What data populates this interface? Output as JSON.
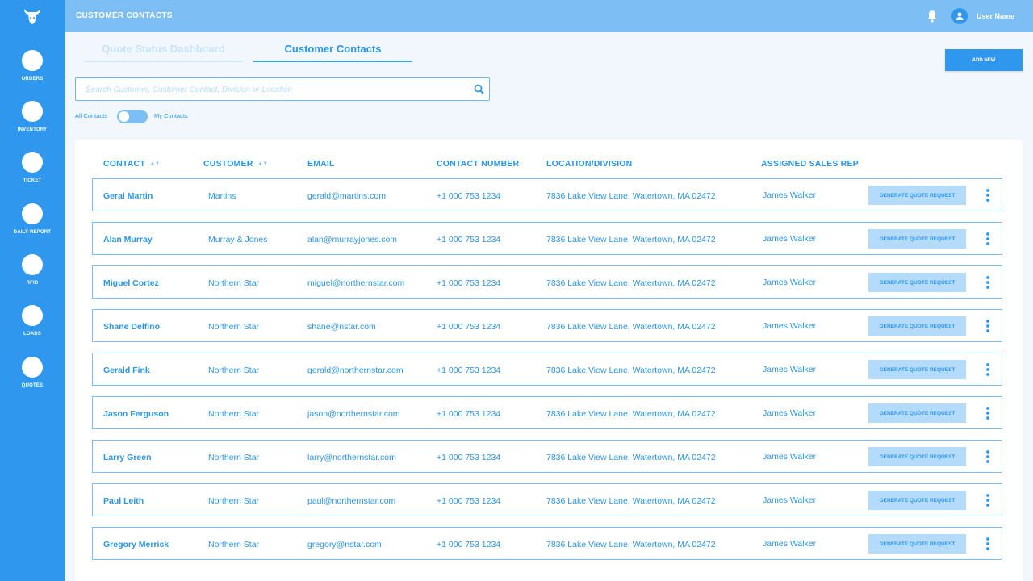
{
  "app": {
    "title": "CUSTOMER CONTACTS",
    "user_name": "User Name"
  },
  "sidebar": {
    "items": [
      {
        "label": "ORDERS",
        "icon": "orders-icon"
      },
      {
        "label": "INVENTORY",
        "icon": "inventory-icon"
      },
      {
        "label": "TICKET",
        "icon": "ticket-icon"
      },
      {
        "label": "DAILY REPORT",
        "icon": "daily-report-icon"
      },
      {
        "label": "RFID",
        "icon": "rfid-icon"
      },
      {
        "label": "LOADS",
        "icon": "loads-icon"
      },
      {
        "label": "QUOTES",
        "icon": "quotes-icon"
      }
    ]
  },
  "tabs": [
    {
      "label": "Quote Status Dashboard",
      "active": false
    },
    {
      "label": "Customer Contacts",
      "active": true
    }
  ],
  "toolbar": {
    "add_label": "ADD NEW"
  },
  "search": {
    "placeholder": "Search Customer, Customer Contact, Division or Location",
    "value": ""
  },
  "toggle": {
    "left_label": "All Contacts",
    "right_label": "My Contacts"
  },
  "table": {
    "headers": {
      "contact": "CONTACT",
      "customer": "CUSTOMER",
      "email": "EMAIL",
      "phone": "CONTACT NUMBER",
      "location": "LOCATION/DIVISION",
      "rep": "ASSIGNED SALES REP"
    },
    "action_label": "GENERATE QUOTE REQUEST",
    "rows": [
      {
        "contact": "Geral Martin",
        "customer": "Martins",
        "email": "gerald@martins.com",
        "phone": "+1 000 753 1234",
        "location": "7836 Lake View Lane, Watertown, MA 02472",
        "rep": "James Walker"
      },
      {
        "contact": "Alan Murray",
        "customer": "Murray & Jones",
        "email": "alan@murrayjones.com",
        "phone": "+1 000 753 1234",
        "location": "7836 Lake View Lane, Watertown, MA 02472",
        "rep": "James Walker"
      },
      {
        "contact": "Miguel Cortez",
        "customer": "Northern Star",
        "email": "miguel@northernstar.com",
        "phone": "+1 000 753 1234",
        "location": "7836 Lake View Lane, Watertown, MA 02472",
        "rep": "James Walker"
      },
      {
        "contact": "Shane Delfino",
        "customer": "Northern Star",
        "email": "shane@nstar.com",
        "phone": "+1 000 753 1234",
        "location": "7836 Lake View Lane, Watertown, MA 02472",
        "rep": "James Walker"
      },
      {
        "contact": "Gerald Fink",
        "customer": "Northern Star",
        "email": "gerald@northernstar.com",
        "phone": "+1 000 753 1234",
        "location": "7836 Lake View Lane, Watertown, MA 02472",
        "rep": "James Walker"
      },
      {
        "contact": "Jason Ferguson",
        "customer": "Northern Star",
        "email": "jason@northernstar.com",
        "phone": "+1 000 753 1234",
        "location": "7836 Lake View Lane, Watertown, MA 02472",
        "rep": "James Walker"
      },
      {
        "contact": "Larry Green",
        "customer": "Northern Star",
        "email": "larry@northernstar.com",
        "phone": "+1 000 753 1234",
        "location": "7836 Lake View Lane, Watertown, MA 02472",
        "rep": "James Walker"
      },
      {
        "contact": "Paul Leith",
        "customer": "Northern Star",
        "email": "paul@northernstar.com",
        "phone": "+1 000 753 1234",
        "location": "7836 Lake View Lane, Watertown, MA 02472",
        "rep": "James Walker"
      },
      {
        "contact": "Gregory Merrick",
        "customer": "Northern Star",
        "email": "gregory@nstar.com",
        "phone": "+1 000 753 1234",
        "location": "7836 Lake View Lane, Watertown, MA 02472",
        "rep": "James Walker"
      }
    ]
  },
  "colors": {
    "primary": "#2f97ee",
    "topbar": "#7dbff5",
    "text": "#2b95e6",
    "button_light": "#b5dbfa"
  }
}
